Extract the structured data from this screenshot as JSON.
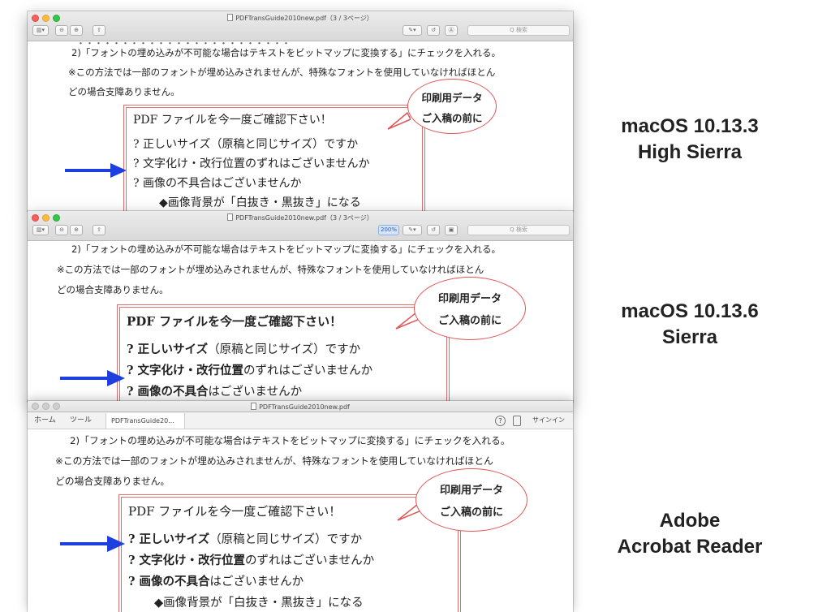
{
  "window1": {
    "title": "PDFTransGuide2010new.pdf（3 / 3ページ）",
    "search_placeholder": "Q 検索",
    "top_partial": "・・・・・・・・・・・・・・・・・・・・・・・・",
    "para1": "2)「フォントの埋め込みが不可能な場合はテキストをビットマップに変換する」にチェックを入れる。",
    "para2": "※この方法では一部のフォントが埋め込みされませんが、特殊なフォントを使用していなければほとん",
    "para3": "どの場合支障ありません。",
    "box_title": "PDF ファイルを今一度ご確認下さい！",
    "item1": "? 正しいサイズ（原稿と同じサイズ）ですか",
    "item2": "? 文字化け・改行位置のずれはございませんか",
    "item3": "? 画像の不具合はございませんか",
    "item4": "◆画像背景が「白抜き・黒抜き」になる",
    "bubble_line1": "印刷用データ",
    "bubble_line2": "ご入稿の前に"
  },
  "window2": {
    "title": "PDFTransGuide2010new.pdf（3 / 3ページ）",
    "zoom": "200%",
    "search_placeholder": "Q 検索",
    "para1": "2)「フォントの埋め込みが不可能な場合はテキストをビットマップに変換する」にチェックを入れる。",
    "para2": "※この方法では一部のフォントが埋め込みされませんが、特殊なフォントを使用していなければほとん",
    "para3": "どの場合支障ありません。",
    "box_title": "PDF ファイルを今一度ご確認下さい！",
    "item1_bold": "? 正しいサイズ",
    "item1_rest": "（原稿と同じサイズ）ですか",
    "item2_bold": "? 文字化け・改行位置",
    "item2_rest": "のずれはございませんか",
    "item3_bold": "? 画像の不具合",
    "item3_rest": "はございませんか",
    "bubble_line1": "印刷用データ",
    "bubble_line2": "ご入稿の前に"
  },
  "window3": {
    "title": "PDFTransGuide2010new.pdf",
    "tab_home": "ホーム",
    "tab_tools": "ツール",
    "tab_doc": "PDFTransGuide20...",
    "tab_close": "×",
    "help_icon": "?",
    "signin": "サインイン",
    "para1": "2)「フォントの埋め込みが不可能な場合はテキストをビットマップに変換する」にチェックを入れる。",
    "para2": "※この方法では一部のフォントが埋め込みされませんが、特殊なフォントを使用していなければほとん",
    "para3": "どの場合支障ありません。",
    "box_title": "PDF ファイルを今一度ご確認下さい！",
    "item1_bold": "? 正しいサイズ",
    "item1_rest": "（原稿と同じサイズ）ですか",
    "item2_bold": "? 文字化け・改行位置",
    "item2_rest": "のずれはございませんか",
    "item3_bold": "? 画像の不具合",
    "item3_rest": "はございませんか",
    "item4": "◆画像背景が「白抜き・黒抜き」になる",
    "bubble_line1": "印刷用データ",
    "bubble_line2": "ご入稿の前に"
  },
  "labels": {
    "label1_line1": "macOS 10.13.3",
    "label1_line2": "High Sierra",
    "label2_line1": "macOS 10.13.6",
    "label2_line2": "Sierra",
    "label3_line1": "Adobe",
    "label3_line2": "Acrobat Reader"
  },
  "colors": {
    "arrow": "#1e3fe0",
    "box_border": "#e06f6f",
    "bubble_border": "#e05555"
  }
}
